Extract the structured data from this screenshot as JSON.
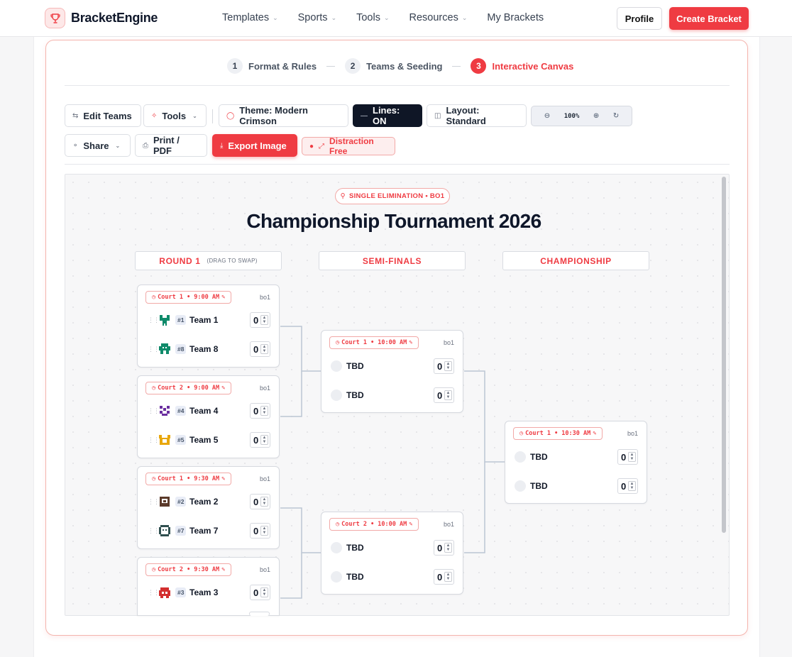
{
  "brand": {
    "name": "BracketEngine"
  },
  "nav": {
    "links": [
      {
        "label": "Templates",
        "dropdown": true
      },
      {
        "label": "Sports",
        "dropdown": true
      },
      {
        "label": "Tools",
        "dropdown": true
      },
      {
        "label": "Resources",
        "dropdown": true
      },
      {
        "label": "My Brackets",
        "dropdown": false
      }
    ],
    "profile_label": "Profile",
    "create_label": "Create Bracket"
  },
  "steps": [
    {
      "num": "1",
      "label": "Format & Rules"
    },
    {
      "num": "2",
      "label": "Teams & Seeding"
    },
    {
      "num": "3",
      "label": "Interactive Canvas"
    }
  ],
  "toolbar": {
    "edit_teams": "Edit Teams",
    "tools": "Tools",
    "theme": "Theme: Modern Crimson",
    "lines": "Lines: ON",
    "layout": "Layout: Standard",
    "zoom": "100%",
    "share": "Share",
    "print": "Print / PDF",
    "export": "Export Image",
    "distraction": "Distraction Free"
  },
  "bracket": {
    "badge": "SINGLE ELIMINATION • BO1",
    "title": "Championship Tournament 2026",
    "rounds": [
      {
        "label": "ROUND 1",
        "hint": "(DRAG TO SWAP)"
      },
      {
        "label": "SEMI-FINALS",
        "hint": ""
      },
      {
        "label": "CHAMPIONSHIP",
        "hint": ""
      }
    ],
    "round1": [
      {
        "time": "Court 1 • 9:00 AM",
        "bo": "bo1",
        "teams": [
          {
            "seed": "#1",
            "name": "Team 1",
            "score": "0",
            "color": "#0f8a6a"
          },
          {
            "seed": "#8",
            "name": "Team 8",
            "score": "0",
            "color": "#0f8a6a"
          }
        ]
      },
      {
        "time": "Court 2 • 9:00 AM",
        "bo": "bo1",
        "teams": [
          {
            "seed": "#4",
            "name": "Team 4",
            "score": "0",
            "color": "#6b2fa0"
          },
          {
            "seed": "#5",
            "name": "Team 5",
            "score": "0",
            "color": "#e8a70c"
          }
        ]
      },
      {
        "time": "Court 1 • 9:30 AM",
        "bo": "bo1",
        "teams": [
          {
            "seed": "#2",
            "name": "Team 2",
            "score": "0",
            "color": "#5b3a2a"
          },
          {
            "seed": "#7",
            "name": "Team 7",
            "score": "0",
            "color": "#2f4f4f"
          }
        ]
      },
      {
        "time": "Court 2 • 9:30 AM",
        "bo": "bo1",
        "teams": [
          {
            "seed": "#3",
            "name": "Team 3",
            "score": "0",
            "color": "#d32f2f"
          }
        ]
      }
    ],
    "semis": [
      {
        "time": "Court 1 • 10:00 AM",
        "bo": "bo1",
        "teams": [
          {
            "name": "TBD",
            "score": "0"
          },
          {
            "name": "TBD",
            "score": "0"
          }
        ]
      },
      {
        "time": "Court 2 • 10:00 AM",
        "bo": "bo1",
        "teams": [
          {
            "name": "TBD",
            "score": "0"
          },
          {
            "name": "TBD",
            "score": "0"
          }
        ]
      }
    ],
    "final": [
      {
        "time": "Court 1 • 10:30 AM",
        "bo": "bo1",
        "teams": [
          {
            "name": "TBD",
            "score": "0"
          },
          {
            "name": "TBD",
            "score": "0"
          }
        ]
      }
    ]
  },
  "colors": {
    "accent": "#ef3b42",
    "dark": "#0f1626"
  }
}
